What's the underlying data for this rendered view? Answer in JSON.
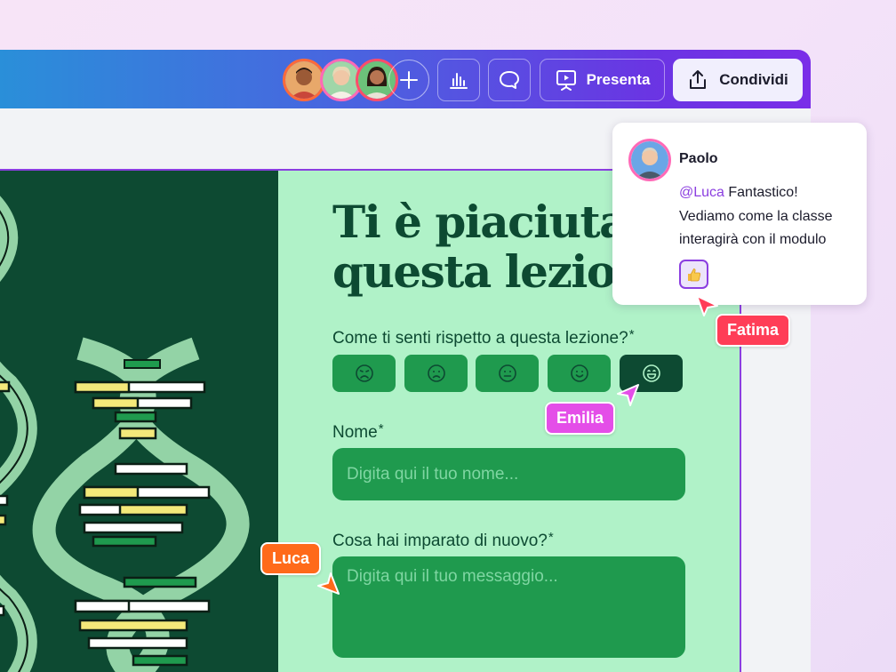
{
  "toolbar": {
    "add_label": "+",
    "present_label": "Presenta",
    "share_label": "Condividi",
    "icons": [
      "add-icon",
      "insights-icon",
      "comment-icon",
      "present-icon",
      "share-icon"
    ]
  },
  "form": {
    "headline_line1": "Ti è piaciuta",
    "headline_line2": "questa lezion",
    "mood_question": "Come ti senti rispetto a questa lezione?",
    "mood_options": [
      "very-sad-face-icon",
      "sad-face-icon",
      "neutral-face-icon",
      "happy-face-icon",
      "very-happy-face-icon"
    ],
    "mood_selected_index": 4,
    "name_label": "Nome",
    "name_placeholder": "Digita qui il tuo nome...",
    "learn_label": "Cosa hai imparato di nuovo?",
    "learn_placeholder": "Digita qui il tuo messaggio...",
    "required_mark": "*"
  },
  "comment": {
    "author": "Paolo",
    "mention": "@Luca",
    "text_rest": " Fantastico! Vediamo come la classe interagirà con il modulo",
    "reaction": "thumbs-up-icon"
  },
  "cursors": {
    "fatima": "Fatima",
    "emilia": "Emilia",
    "luca": "Luca"
  },
  "colors": {
    "slide_dark": "#0d4a32",
    "slide_light": "#b0f2c8",
    "field_green": "#1f9a4e",
    "accent_purple": "#8b3ee0",
    "fatima": "#ff3d57",
    "emilia": "#e44ee8",
    "luca": "#ff6a1a"
  }
}
